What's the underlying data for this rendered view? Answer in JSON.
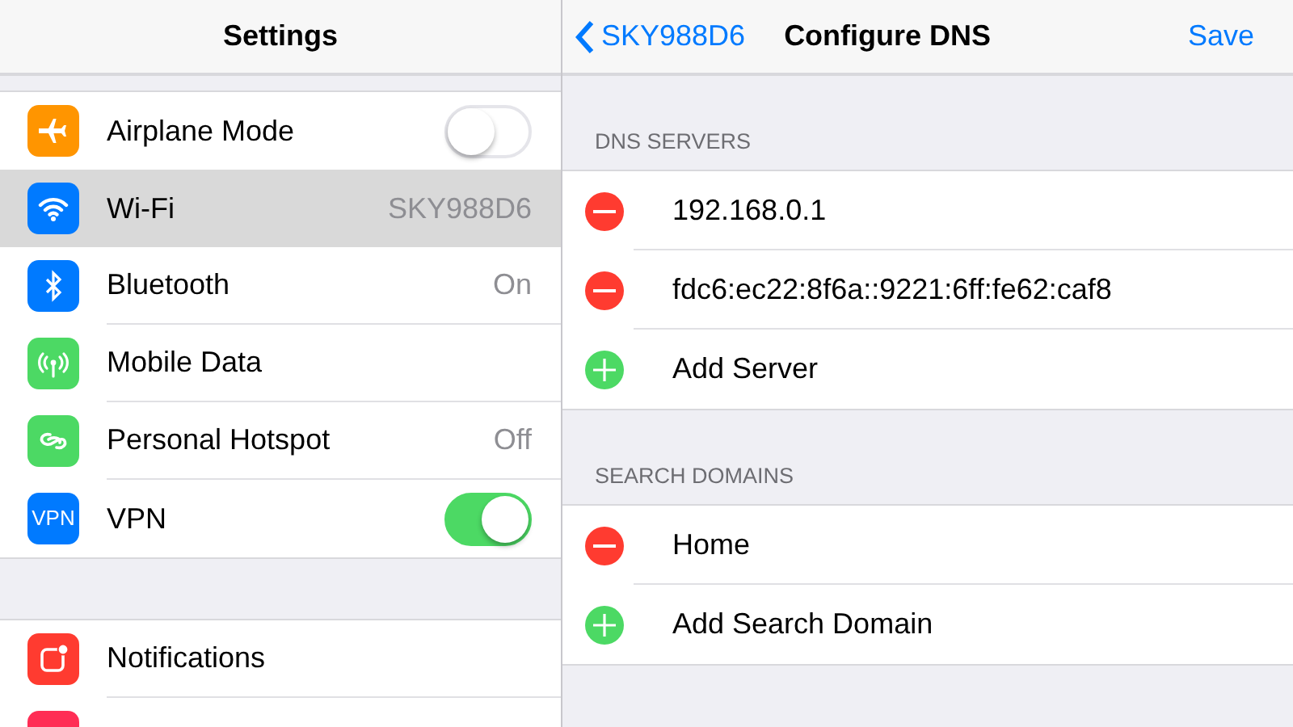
{
  "settings": {
    "title": "Settings",
    "groups": [
      {
        "items": [
          {
            "label": "Airplane Mode",
            "kind": "toggle",
            "on": false,
            "selected": false
          },
          {
            "label": "Wi-Fi",
            "kind": "value",
            "value": "SKY988D6",
            "selected": true
          },
          {
            "label": "Bluetooth",
            "kind": "value",
            "value": "On",
            "selected": false
          },
          {
            "label": "Mobile Data",
            "kind": "link",
            "selected": false
          },
          {
            "label": "Personal Hotspot",
            "kind": "value",
            "value": "Off",
            "selected": false
          },
          {
            "label": "VPN",
            "kind": "toggle",
            "on": true,
            "selected": false,
            "icon_text": "VPN"
          }
        ]
      },
      {
        "items": [
          {
            "label": "Notifications",
            "kind": "link",
            "selected": false
          },
          {
            "kind": "link",
            "selected": false
          }
        ]
      }
    ]
  },
  "dns": {
    "back": "SKY988D6",
    "title": "Configure DNS",
    "save": "Save",
    "sections": [
      {
        "header": "DNS SERVERS",
        "rows": [
          {
            "kind": "remove",
            "text": "192.168.0.1"
          },
          {
            "kind": "remove",
            "text": "fdc6:ec22:8f6a::9221:6ff:fe62:caf8"
          },
          {
            "kind": "add",
            "text": "Add Server"
          }
        ]
      },
      {
        "header": "SEARCH DOMAINS",
        "rows": [
          {
            "kind": "remove",
            "text": "Home"
          },
          {
            "kind": "add",
            "text": "Add Search Domain"
          }
        ]
      }
    ]
  }
}
